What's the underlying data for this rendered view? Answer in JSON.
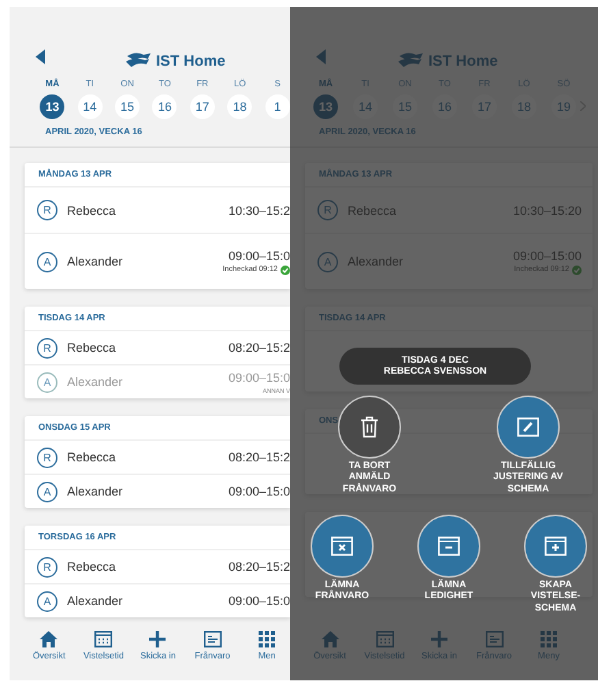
{
  "screens": [
    {
      "kind": "plain",
      "logo": "IST Home",
      "next_arrow": false,
      "week_days": [
        {
          "label": "MÅ",
          "date": "13",
          "selected": true
        },
        {
          "label": "TI",
          "date": "14",
          "selected": false
        },
        {
          "label": "ON",
          "date": "15",
          "selected": false
        },
        {
          "label": "TO",
          "date": "16",
          "selected": false
        },
        {
          "label": "FR",
          "date": "17",
          "selected": false
        },
        {
          "label": "LÖ",
          "date": "18",
          "selected": false
        },
        {
          "label": "S",
          "date": "1",
          "selected": false
        }
      ],
      "week_label": "APRIL 2020, VECKA 16",
      "days": [
        {
          "title": "MÅNDAG 13 APR",
          "rows": [
            {
              "initial": "R",
              "name": "Rebecca",
              "time": "10:30–15:2",
              "dimmed": false
            },
            {
              "initial": "A",
              "name": "Alexander",
              "time": "09:00–15:0",
              "note": "Incheckad 09:12",
              "checked_in": true,
              "dimmed": false
            }
          ]
        },
        {
          "title": "TISDAG 14 APR",
          "rows": [
            {
              "initial": "R",
              "name": "Rebecca",
              "time": "08:20–15:2",
              "dimmed": false
            },
            {
              "initial": "A",
              "name": "Alexander",
              "time": "09:00–15:0",
              "note": "ANNAN V",
              "checked_in": false,
              "dimmed": true
            }
          ]
        },
        {
          "title": "ONSDAG 15 APR",
          "rows": [
            {
              "initial": "R",
              "name": "Rebecca",
              "time": "08:20–15:2",
              "dimmed": false
            },
            {
              "initial": "A",
              "name": "Alexander",
              "time": "09:00–15:0",
              "dimmed": false
            }
          ]
        },
        {
          "title": "TORSDAG 16 APR",
          "rows": [
            {
              "initial": "R",
              "name": "Rebecca",
              "time": "08:20–15:2",
              "dimmed": false
            },
            {
              "initial": "A",
              "name": "Alexander",
              "time": "09:00–15:0",
              "dimmed": false
            }
          ]
        }
      ],
      "tabs": [
        {
          "label": "Översikt",
          "kind": "home"
        },
        {
          "label": "Vistelsetid",
          "kind": "calendar"
        },
        {
          "label": "Skicka in",
          "kind": "plus"
        },
        {
          "label": "Frånvaro",
          "kind": "absence"
        },
        {
          "label": "Men",
          "kind": "grid"
        }
      ]
    },
    {
      "kind": "overlay",
      "logo": "IST Home",
      "next_arrow": true,
      "week_days": [
        {
          "label": "MÅ",
          "date": "13",
          "selected": true
        },
        {
          "label": "TI",
          "date": "14",
          "selected": false
        },
        {
          "label": "ON",
          "date": "15",
          "selected": false
        },
        {
          "label": "TO",
          "date": "16",
          "selected": false
        },
        {
          "label": "FR",
          "date": "17",
          "selected": false
        },
        {
          "label": "LÖ",
          "date": "18",
          "selected": false
        },
        {
          "label": "SÖ",
          "date": "19",
          "selected": false
        }
      ],
      "week_label": "APRIL 2020, VECKA 16",
      "days": [
        {
          "title": "MÅNDAG 13 APR",
          "rows": [
            {
              "initial": "R",
              "name": "Rebecca",
              "time": "10:30–15:20",
              "dimmed": false
            },
            {
              "initial": "A",
              "name": "Alexander",
              "time": "09:00–15:00",
              "note": "Incheckad 09:12",
              "checked_in": true,
              "dimmed": false
            }
          ]
        },
        {
          "title": "TISDAG 14 APR"
        },
        {
          "title": "ONS"
        }
      ],
      "tabs": [
        {
          "label": "Översikt",
          "kind": "home"
        },
        {
          "label": "Vistelsetid",
          "kind": "calendar"
        },
        {
          "label": "Skicka in",
          "kind": "plus"
        },
        {
          "label": "Frånvaro",
          "kind": "absence"
        },
        {
          "label": "Meny",
          "kind": "grid"
        }
      ],
      "overlay": {
        "title": "TISDAG 4 DEC",
        "subtitle": "REBECCA SVENSSON",
        "actions": [
          {
            "label": "TA BORT ANMÄLD FRÅNVARO",
            "kind": "trash",
            "enabled": false
          },
          {
            "label": "TILLFÄLLIG JUSTERING AV SCHEMA",
            "kind": "edit",
            "enabled": true
          },
          {
            "label": "LÄMNA FRÅNVARO",
            "kind": "cross",
            "enabled": true
          },
          {
            "label": "LÄMNA LEDIGHET",
            "kind": "minus",
            "enabled": true
          },
          {
            "label": "SKAPA VISTELSE-SCHEMA",
            "kind": "add",
            "enabled": true
          }
        ]
      }
    }
  ]
}
